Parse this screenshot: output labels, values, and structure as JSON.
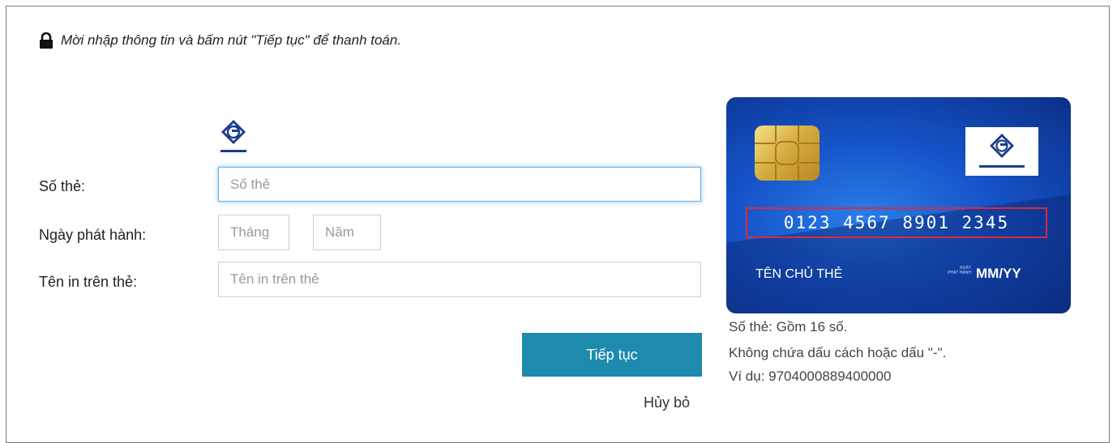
{
  "notice": {
    "text": "Mời nhập thông tin và bấm nút \"Tiếp tục\" để thanh toán.",
    "icon": "lock-icon"
  },
  "bank_logo": {
    "name": "SAIGONBANK"
  },
  "form": {
    "card_number_label": "Số thẻ:",
    "card_number_placeholder": "Số thẻ",
    "card_number_value": "",
    "issue_date_label": "Ngày phát hành:",
    "month_placeholder": "Tháng",
    "year_placeholder": "Năm",
    "name_label": "Tên in trên thẻ:",
    "name_placeholder": "Tên in trên thẻ",
    "continue_label": "Tiếp tục",
    "cancel_label": "Hủy bỏ"
  },
  "card": {
    "number": "0123 4567 8901 2345",
    "holder": "TÊN CHỦ THẺ",
    "issue_label_line1": "NGÀY",
    "issue_label_line2": "PHÁT HÀNH",
    "expiry": "MM/YY",
    "logo_name": "SAIGONBANK"
  },
  "hints": {
    "line1": "Số thẻ: Gồm 16 số.",
    "line2": "Không chứa dấu cách hoặc dấu \"-\".",
    "line3": "Ví dụ: 9704000889400000"
  },
  "colors": {
    "button": "#1e8aae",
    "card_blue": "#1553c8",
    "card_number_border": "#e0283a",
    "focus": "#66afe9"
  }
}
